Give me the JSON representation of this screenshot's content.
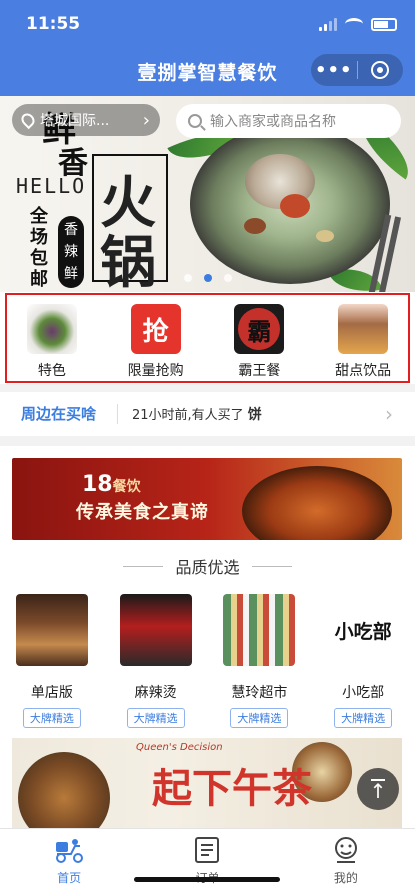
{
  "status": {
    "time": "11:55"
  },
  "header": {
    "title": "壹捌掌智慧餐饮",
    "more_label": "•••"
  },
  "location": {
    "text": "塔城国际..."
  },
  "search": {
    "placeholder": "输入商家或商品名称"
  },
  "banner": {
    "char1": "鲜",
    "char2": "香",
    "hello": "HELLO",
    "big1": "火",
    "big2": "锅",
    "vertical": "全场包邮",
    "seal": "香辣鲜",
    "slide_count": 3,
    "active_slide": 1
  },
  "categories": [
    {
      "label": "特色",
      "icon": "dish-image"
    },
    {
      "label": "限量抢购",
      "icon": "grab-icon",
      "glyph": "抢"
    },
    {
      "label": "霸王餐",
      "icon": "bawang-icon",
      "glyph": "霸"
    },
    {
      "label": "甜点饮品",
      "icon": "dessert-image"
    }
  ],
  "ticker": {
    "head": "周边在买啥",
    "message": "21小时前,有人买了",
    "item": "饼"
  },
  "promo": {
    "logo_num": "18",
    "logo_text": "餐饮",
    "slogan": "传承美食之真谛"
  },
  "section": {
    "title": "品质优选"
  },
  "brands": [
    {
      "name": "单店版",
      "tag": "大牌精选"
    },
    {
      "name": "麻辣烫",
      "tag": "大牌精选"
    },
    {
      "name": "慧玲超市",
      "tag": "大牌精选"
    },
    {
      "name": "小吃部",
      "tag": "大牌精选",
      "logo_text": "小吃部"
    }
  ],
  "promo2": {
    "small": "Queen's Decision",
    "big": "起下午茶"
  },
  "tabs": [
    {
      "label": "首页",
      "active": true
    },
    {
      "label": "订单",
      "active": false
    },
    {
      "label": "我的",
      "active": false
    }
  ],
  "colors": {
    "primary": "#4a7ee0",
    "accent": "#3c7de0",
    "highlight": "#e21e1e"
  }
}
